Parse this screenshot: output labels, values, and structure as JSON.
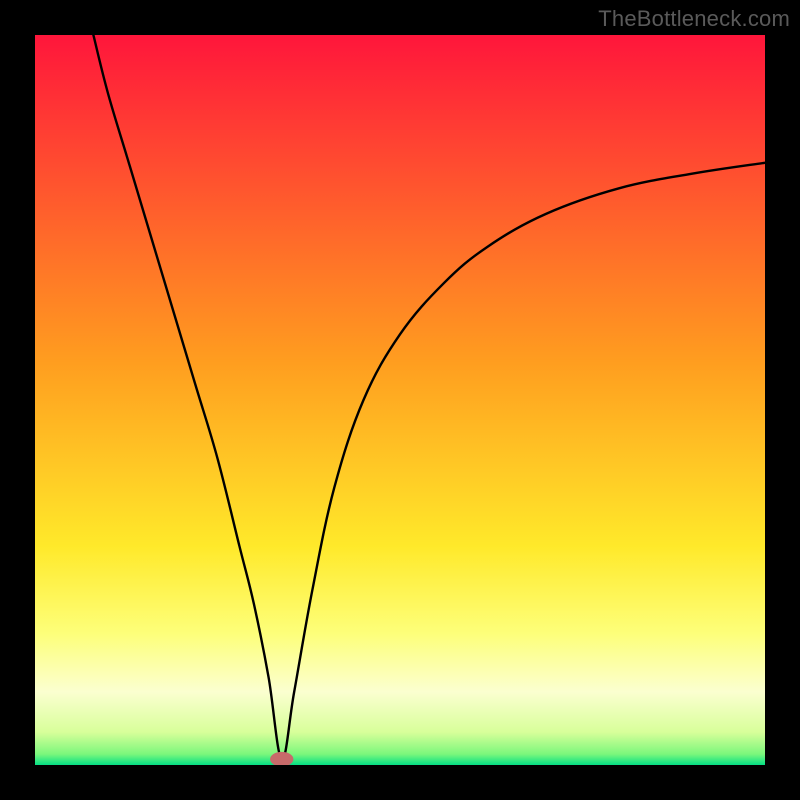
{
  "watermark": "TheBottleneck.com",
  "chart_data": {
    "type": "line",
    "title": "",
    "xlabel": "",
    "ylabel": "",
    "xlim": [
      0,
      100
    ],
    "ylim": [
      0,
      100
    ],
    "legend": false,
    "grid": false,
    "gradient_stops": [
      {
        "offset": 0.0,
        "color": "#ff163b"
      },
      {
        "offset": 0.45,
        "color": "#ff9e1f"
      },
      {
        "offset": 0.7,
        "color": "#ffe92a"
      },
      {
        "offset": 0.82,
        "color": "#fdff7a"
      },
      {
        "offset": 0.9,
        "color": "#fbffd0"
      },
      {
        "offset": 0.955,
        "color": "#d8ff9a"
      },
      {
        "offset": 0.985,
        "color": "#7cf77c"
      },
      {
        "offset": 1.0,
        "color": "#04df84"
      }
    ],
    "marker": {
      "x": 33.8,
      "y": 0.8,
      "rx": 1.6,
      "ry": 1.0,
      "color": "#c76a6a"
    },
    "series": [
      {
        "name": "curve",
        "x": [
          8.0,
          10.0,
          13.0,
          16.0,
          19.0,
          22.0,
          25.0,
          28.0,
          30.0,
          32.0,
          33.8,
          35.5,
          38.0,
          41.0,
          45.0,
          50.0,
          56.0,
          62.0,
          70.0,
          80.0,
          90.0,
          100.0
        ],
        "values": [
          100.0,
          92.0,
          82.0,
          72.0,
          62.0,
          52.0,
          42.0,
          30.0,
          22.0,
          12.0,
          0.8,
          10.0,
          24.0,
          38.0,
          50.0,
          59.0,
          66.0,
          71.0,
          75.5,
          79.0,
          81.0,
          82.5
        ]
      }
    ]
  }
}
